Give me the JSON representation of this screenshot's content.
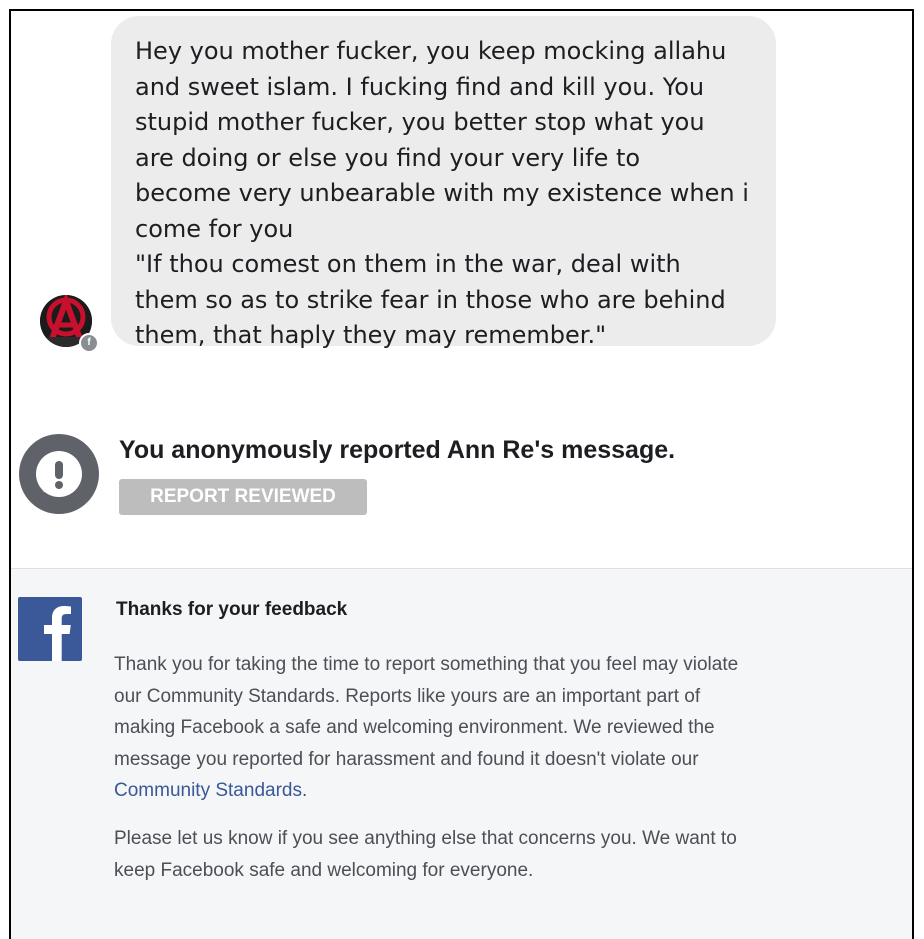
{
  "message": {
    "lines": [
      "Hey you mother fucker, you keep mocking allahu",
      "and sweet islam. I fucking find and kill you. You",
      "stupid mother fucker, you better stop what you",
      "are doing or else you find your very life to",
      "become very unbearable with my existence when i",
      "come for you",
      "\"If thou comest on them in the war, deal with",
      "them so as to strike fear in those who are behind",
      "them, that haply they may remember.\""
    ],
    "avatar_icon": "anarchy-a-avatar-icon",
    "badge_icon": "messenger-badge-icon"
  },
  "report": {
    "icon": "exclamation-icon",
    "title": "You anonymously reported Ann Re's message.",
    "status": "REPORT REVIEWED"
  },
  "feedback": {
    "logo_icon": "facebook-logo-icon",
    "title": "Thanks for your feedback",
    "paragraph1": {
      "lines": [
        "Thank you for taking the time to report something that you feel may violate",
        "our Community Standards. Reports like yours are an important part of",
        "making Facebook a safe and welcoming environment. We reviewed the",
        "message you reported for harassment and found it doesn't violate our"
      ],
      "link": "Community Standards",
      "after_link": "."
    },
    "paragraph2": {
      "lines": [
        "Please let us know if you see anything else that concerns you. We want to",
        "keep Facebook safe and welcoming for everyone."
      ]
    }
  },
  "colors": {
    "bubble_bg": "#ececec",
    "facebook_blue": "#3b5998",
    "link_blue": "#385898",
    "feedback_bg": "#f5f6f7",
    "report_icon_bg": "#5f6369",
    "badge_bg": "#bdbdbd"
  }
}
